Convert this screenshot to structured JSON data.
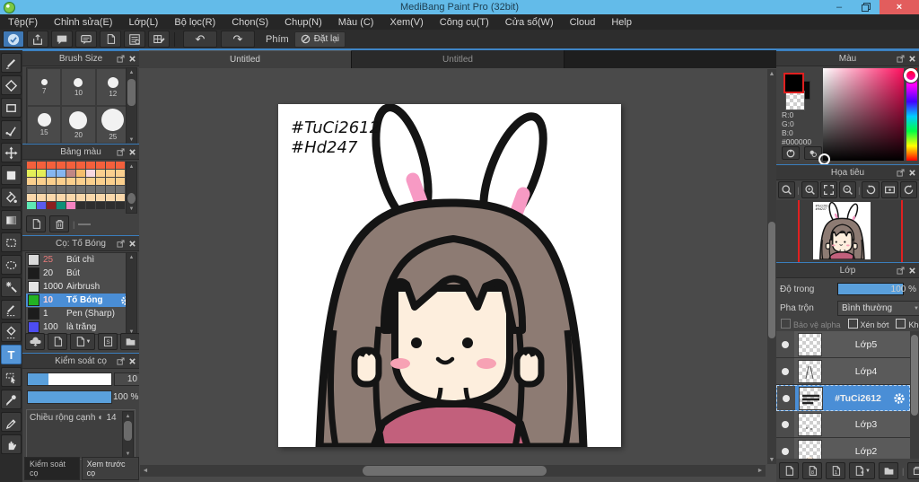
{
  "window": {
    "title": "MediBang Paint Pro (32bit)",
    "minimize": "–",
    "close": "×"
  },
  "menu": {
    "items": [
      "Tệp(F)",
      "Chỉnh sửa(E)",
      "Lớp(L)",
      "Bộ lọc(R)",
      "Chọn(S)",
      "Chụp(N)",
      "Màu (C)",
      "Xem(V)",
      "Công cụ(T)",
      "Cửa sổ(W)",
      "Cloud",
      "Help"
    ]
  },
  "toolbar": {
    "key_label": "Phím",
    "reset_label": "Đặt lại",
    "undo": "↶",
    "redo": "↷"
  },
  "tabs": {
    "tab1": "Untitled",
    "tab2": "Untitled"
  },
  "artwork": {
    "line1": "#TuCi2612",
    "line2": "#Hd247"
  },
  "icons": {
    "close": "×",
    "up": "▲",
    "down": "▼",
    "left": "◄",
    "right": "►",
    "dd": "▼",
    "half": "◐"
  },
  "colors": {
    "accent": "#4a90d8",
    "titlebar": "#63bbe9",
    "close_btn": "#e25d5d",
    "hair": "#8d7b73",
    "skin": "#fdeedd",
    "shirt": "#c2607c",
    "ear_pink": "#f79ac4"
  },
  "panels": {
    "brush_size": {
      "title": "Brush Size",
      "sizes": [
        7,
        10,
        12,
        15,
        20,
        25
      ]
    },
    "palette": {
      "title": "Bảng màu",
      "rows": [
        [
          "#f4603c",
          "#f4603c",
          "#f4603c",
          "#f4603c",
          "#f4603c",
          "#f4603c",
          "#f4603c",
          "#f4603c",
          "#f4603c",
          "#f4603c"
        ],
        [
          "#e4ee58",
          "#e4ee58",
          "#86b6f0",
          "#86b6f0",
          "#c18784",
          "#f6be6c",
          "#f8d7e0",
          "#fbcf8e",
          "#fbcf8e",
          "#fbcf8e"
        ],
        [
          "#fbcf8d",
          "#fbcf8d",
          "#fbcf8d",
          "#fbcf8d",
          "#fbcf8d",
          "#fbcf8d",
          "#fbcf8d",
          "#fbcf8d",
          "#fbcf8d",
          "#fbcf8d"
        ],
        [
          "#6f6f6f",
          "#6f6f6f",
          "#6f6f6f",
          "#6f6f6f",
          "#6f6f6f",
          "#6f6f6f",
          "#6f6f6f",
          "#6f6f6f",
          "#6f6f6f",
          "#6f6f6f"
        ],
        [
          "#fad8ab",
          "#fad8ab",
          "#fad8ab",
          "#fad8ab",
          "#fad8ab",
          "#fad8ab",
          "#fad8ab",
          "#fad8ab",
          "#fad8ab",
          "#fad8ab"
        ],
        [
          "#5ee8b4",
          "#5b5bee",
          "#8c1f1f",
          "#0f8f78",
          "#f683c2",
          null,
          null,
          null,
          null,
          null
        ]
      ]
    },
    "brushes": {
      "title": "Cọ: Tố Bóng",
      "items": [
        {
          "size": "25",
          "name": "Bút chì",
          "swatch": "#d9d9d9",
          "size_color": "#e87a7a"
        },
        {
          "size": "20",
          "name": "Bút",
          "swatch": "#1c1c1c",
          "size_color": "#e8e8e8"
        },
        {
          "size": "1000",
          "name": "Airbrush",
          "swatch": "#e4e4e4",
          "size_color": "#e8e8e8"
        },
        {
          "size": "10",
          "name": "Tố Bóng",
          "swatch": "#23b223",
          "size_color": "#ffd5d5",
          "selected": true
        },
        {
          "size": "1",
          "name": "Pen (Sharp)",
          "swatch": "#1c1c1c",
          "size_color": "#e8e8e8"
        },
        {
          "size": "100",
          "name": "là trắng",
          "swatch": "#4d4df0",
          "size_color": "#e8e8e8"
        }
      ]
    },
    "brush_ctrl": {
      "title": "Kiểm soát cọ",
      "value1": "10",
      "value2": "100 %",
      "row_label": "Chiều rộng cạnh",
      "row_value": "14",
      "tab1": "Kiểm soát cọ",
      "tab2": "Xem trước cọ"
    },
    "color": {
      "title": "Màu",
      "r": "R:0",
      "g": "G:0",
      "b": "B:0",
      "hex": "#000000"
    },
    "navigator": {
      "title": "Họa tiêu"
    },
    "layers": {
      "title": "Lớp",
      "opacity_label": "Độ trong",
      "opacity_value": "100 %",
      "blend_label": "Pha trộn",
      "blend_value": "Bình thường",
      "cb1": "Bảo vệ alpha",
      "cb2": "Xén bớt",
      "cb3": "Khóa",
      "items": [
        {
          "name": "Lớp5"
        },
        {
          "name": "Lớp4"
        },
        {
          "name": "#TuCi2612",
          "selected": true
        },
        {
          "name": "Lớp3"
        },
        {
          "name": "Lớp2"
        }
      ]
    }
  }
}
